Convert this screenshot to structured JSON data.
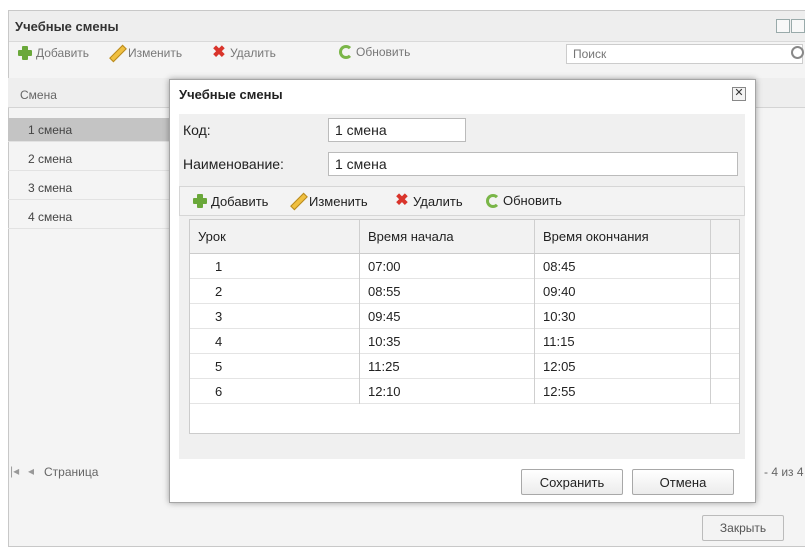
{
  "background_window": {
    "title": "Учебные смены",
    "toolbar": {
      "add_label": "Добавить",
      "edit_label": "Изменить",
      "delete_label": "Удалить",
      "refresh_label": "Обновить",
      "search_placeholder": "Поиск"
    },
    "grid": {
      "column_header": "Смена",
      "rows": [
        "1 смена",
        "2 смена",
        "3 смена",
        "4 смена"
      ]
    },
    "paging": {
      "page_label": "Страница",
      "range_text": "- 4 из 4"
    },
    "close_label": "Закрыть"
  },
  "dialog": {
    "title": "Учебные смены",
    "code_label": "Код:",
    "code_value": "1 смена",
    "name_label": "Наименование:",
    "name_value": "1 смена",
    "toolbar": {
      "add_label": "Добавить",
      "edit_label": "Изменить",
      "delete_label": "Удалить",
      "refresh_label": "Обновить"
    },
    "table": {
      "headers": [
        "Урок",
        "Время начала",
        "Время окончания"
      ],
      "rows": [
        [
          "1",
          "07:00",
          "08:45"
        ],
        [
          "2",
          "08:55",
          "09:40"
        ],
        [
          "3",
          "09:45",
          "10:30"
        ],
        [
          "4",
          "10:35",
          "11:15"
        ],
        [
          "5",
          "11:25",
          "12:05"
        ],
        [
          "6",
          "12:10",
          "12:55"
        ]
      ]
    },
    "save_label": "Сохранить",
    "cancel_label": "Отмена"
  },
  "colors": {
    "selected_row": "#c4c4c4",
    "add_icon": "#6aa83a",
    "delete_icon": "#d9342b"
  }
}
